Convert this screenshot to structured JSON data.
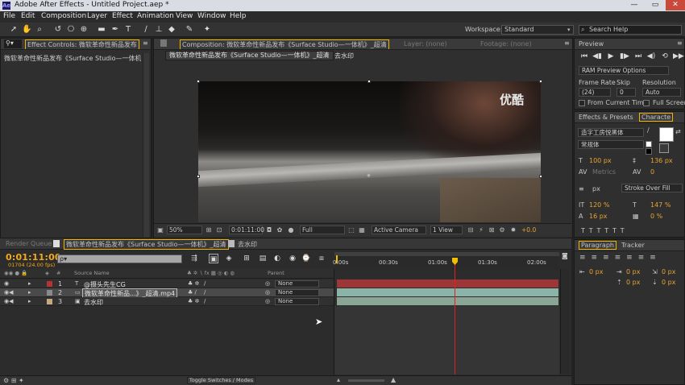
{
  "window": {
    "app_icon": "Ae",
    "title": "Adobe After Effects - Untitled Project.aep *",
    "buttons": [
      "—",
      "▭",
      "✕"
    ]
  },
  "menu": [
    "File",
    "Edit",
    "Composition",
    "Layer",
    "Effect",
    "Animation",
    "View",
    "Window",
    "Help"
  ],
  "toolbar": {
    "workspace_label": "Workspace:",
    "workspace_value": "Standard",
    "search_placeholder": "Search Help",
    "tools": [
      "select-tool",
      "hand-tool",
      "zoom-tool",
      "rotate-tool",
      "camera-tool",
      "pan-behind-tool",
      "rectangle-tool",
      "pen-tool",
      "type-tool",
      "brush-tool",
      "clone-stamp-tool",
      "eraser-tool",
      "roto-brush-tool",
      "puppet-tool"
    ]
  },
  "effect_controls": {
    "tab": "Effect Controls: 微软革命性新品发布",
    "subtitle": "微软革命性新品发布《Surface Studio—一体机》_超清"
  },
  "composition": {
    "tab": "Composition: 微软革命性新品发布《Surface Studio—一体机》_超清",
    "layer_tab": "Layer: (none)",
    "footage_tab": "Footage: (none)",
    "breadcrumbs": [
      "微软革命性新品发布《Surface Studio—一体机》_超清",
      "去水印"
    ],
    "watermark_text": "优酷",
    "footer": {
      "zoom": "50%",
      "timecode": "0:01:11:00",
      "resolution": "Full",
      "camera": "Active Camera",
      "view": "1 View",
      "exposure": "+0.0"
    }
  },
  "timeline": {
    "tabs": [
      "Render Queue",
      "微软革命性新品发布《Surface Studio—一体机》_超清",
      "去水印"
    ],
    "timecode": "0:01:11:00",
    "fps": "01704 (24.00 fps)",
    "search_placeholder": "ρ▾",
    "column_headers": {
      "num": "#",
      "source_name": "Source Name",
      "parent": "Parent"
    },
    "ruler_labels": [
      "0:00s",
      "00:30s",
      "01:00s",
      "01:30s",
      "02:00s"
    ],
    "layers": [
      {
        "num": "1",
        "name": "@摄头先生CG",
        "parent": "None",
        "label_color": "#b83232",
        "bar_color": "#9d3636"
      },
      {
        "num": "2",
        "name": "微软革命性新品...》_超清.mp4",
        "parent": "None",
        "label_color": "#8a8a8a",
        "bar_color": "#8bb3a8"
      },
      {
        "num": "3",
        "name": "去水印",
        "parent": "None",
        "label_color": "#c6a880",
        "bar_color": "#8aa596"
      }
    ],
    "toggle_label": "Toggle Switches / Modes"
  },
  "preview": {
    "tab": "Preview",
    "ram_options": "RAM Preview Options",
    "frame_rate_label": "Frame Rate",
    "skip_label": "Skip",
    "resolution_label": "Resolution",
    "frame_rate_value": "(24)",
    "skip_value": "0",
    "resolution_value": "Auto",
    "from_current_time": "From Current Time",
    "full_screen": "Full Screen"
  },
  "character": {
    "tabs": [
      "Effects & Presets",
      "Characte"
    ],
    "font_family": "造字工房悦黑体",
    "font_style": "常规体",
    "font_size": "100 px",
    "leading": "136 px",
    "kerning": "Metrics",
    "tracking": "0",
    "stroke_width": "px",
    "stroke_type": "Stroke Over Fill",
    "vert_scale": "120 %",
    "horiz_scale": "147 %",
    "baseline_shift": "16 px",
    "tsume": "0 %"
  },
  "paragraph": {
    "tabs": [
      "Paragraph",
      "Tracker"
    ],
    "indent_left": "0 px",
    "indent_right": "0 px",
    "indent_first": "0 px",
    "space_before": "0 px",
    "space_after": "0 px"
  },
  "colors": {
    "timecode": "#f2a91d",
    "playhead": "#dd2222",
    "accent_tab": "#f0b400"
  }
}
